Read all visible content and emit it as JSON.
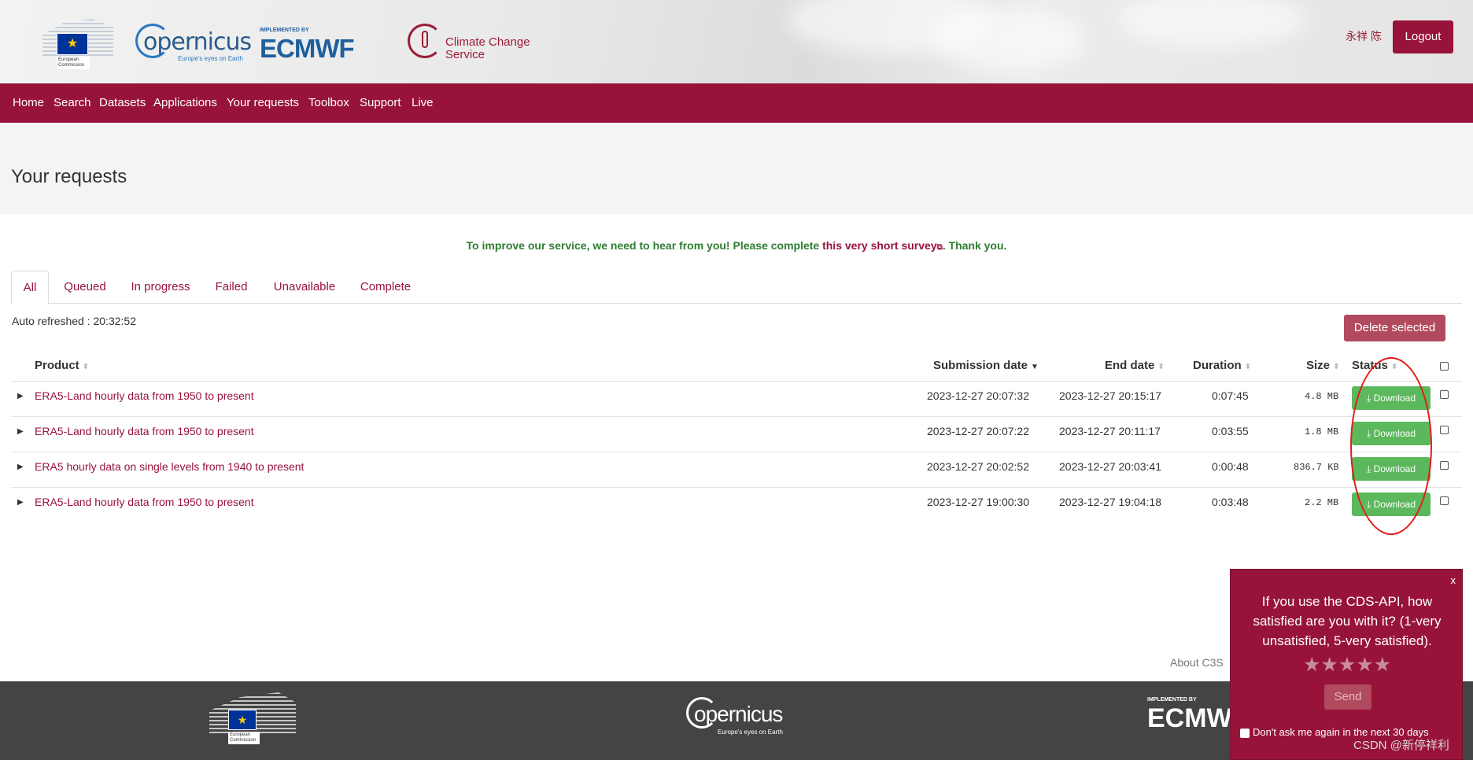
{
  "header": {
    "eu_logo_text": "European Commission",
    "eu_stars": "★",
    "copernicus_word": "opernicus",
    "copernicus_tagline": "Europe's eyes on Earth",
    "ecmwf_implemented_by": "IMPLEMENTED BY",
    "ecmwf_word": "ECMWF",
    "c3s_line1": "Climate Change",
    "c3s_line2": "Service",
    "user_name": "永祥 陈",
    "logout_label": "Logout"
  },
  "nav": {
    "items": [
      "Home",
      "Search",
      "Datasets",
      "Applications",
      "Your requests",
      "Toolbox",
      "Support",
      "Live"
    ]
  },
  "page": {
    "title": "Your requests",
    "survey_prefix": "To improve our service, we need to hear from you! Please complete ",
    "survey_link": "this very short survey",
    "survey_suffix": ". Thank you.",
    "ext_icon": "⧉"
  },
  "tabs": [
    "All",
    "Queued",
    "In progress",
    "Failed",
    "Unavailable",
    "Complete"
  ],
  "toolbar": {
    "auto_refreshed": "Auto refreshed : 20:32:52",
    "delete_label": "Delete selected"
  },
  "table": {
    "headers": {
      "product": "Product",
      "submission_date": "Submission date",
      "end_date": "End date",
      "duration": "Duration",
      "size": "Size",
      "status": "Status"
    },
    "sort_icon": "⬍",
    "sort_active_icon": "▼",
    "caret": "▶",
    "download_label": "⤓ Download",
    "rows": [
      {
        "product": "ERA5-Land hourly data from 1950 to present",
        "submitted": "2023-12-27 20:07:32",
        "ended": "2023-12-27 20:15:17",
        "duration": "0:07:45",
        "size": "4.8 MB"
      },
      {
        "product": "ERA5-Land hourly data from 1950 to present",
        "submitted": "2023-12-27 20:07:22",
        "ended": "2023-12-27 20:11:17",
        "duration": "0:03:55",
        "size": "1.8 MB"
      },
      {
        "product": "ERA5 hourly data on single levels from 1940 to present",
        "submitted": "2023-12-27 20:02:52",
        "ended": "2023-12-27 20:03:41",
        "duration": "0:00:48",
        "size": "836.7 KB"
      },
      {
        "product": "ERA5-Land hourly data from 1950 to present",
        "submitted": "2023-12-27 19:00:30",
        "ended": "2023-12-27 19:04:18",
        "duration": "0:03:48",
        "size": "2.2 MB"
      }
    ]
  },
  "footer": {
    "about": "About C3S",
    "eu_text": "European Commission",
    "copernicus_word": "opernicus",
    "copernicus_tagline": "Europe's eyes on Earth",
    "ecmwf_implemented_by": "IMPLEMENTED BY",
    "ecmwf_word": "ECMWF"
  },
  "popup": {
    "close": "x",
    "question": "If you use the CDS-API, how satisfied are you with it? (1-very unsatisfied, 5-very satisfied).",
    "stars": "★★★★★",
    "send_label": "Send",
    "dont_ask": "Don't ask me again in the next 30 days"
  },
  "watermark": "CSDN @新停祥利",
  "colors": {
    "brand": "#98133a",
    "download": "#5cb85c",
    "survey_text": "#2e7d32",
    "annotation": "#e21b1b"
  }
}
